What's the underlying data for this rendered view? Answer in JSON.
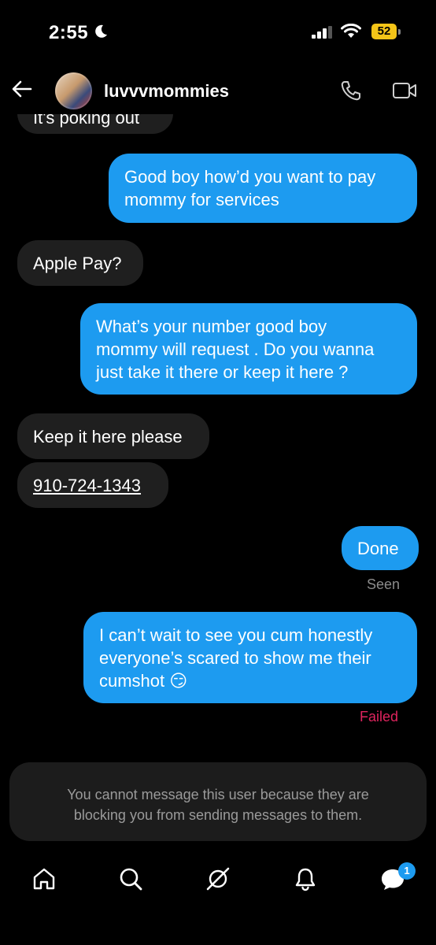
{
  "status_bar": {
    "time": "2:55",
    "battery": "52"
  },
  "header": {
    "username": "luvvvmommies"
  },
  "messages": [
    {
      "direction": "in",
      "text": "It's poking out"
    },
    {
      "direction": "out",
      "lines": [
        "Good boy how’d you want to pay",
        "mommy for services"
      ]
    },
    {
      "direction": "in",
      "text": "Apple Pay?"
    },
    {
      "direction": "out",
      "lines": [
        "What’s your number good boy",
        "mommy will request . Do you wanna",
        "just take it there or keep it here ?"
      ]
    },
    {
      "direction": "in",
      "text": "Keep it here please"
    },
    {
      "direction": "in",
      "text": "910-724-1343"
    },
    {
      "direction": "out",
      "text": "Done",
      "status": "Seen"
    },
    {
      "direction": "out",
      "lines": [
        "I can’t wait to see you cum honestly",
        "everyone’s scared to show me their",
        "cumshot 😏"
      ],
      "status": "Failed"
    }
  ],
  "blocked_notice": {
    "line1": "You cannot message this user because they are",
    "line2": "blocking you from sending messages to them."
  },
  "nav": {
    "items": [
      "home-icon",
      "search-icon",
      "grok-icon",
      "notifications-icon",
      "messages-icon"
    ],
    "messages_badge": "1"
  },
  "colors": {
    "outgoing": "#1d9bf0",
    "incoming": "#1f1f1f",
    "failed": "#e0245e"
  }
}
